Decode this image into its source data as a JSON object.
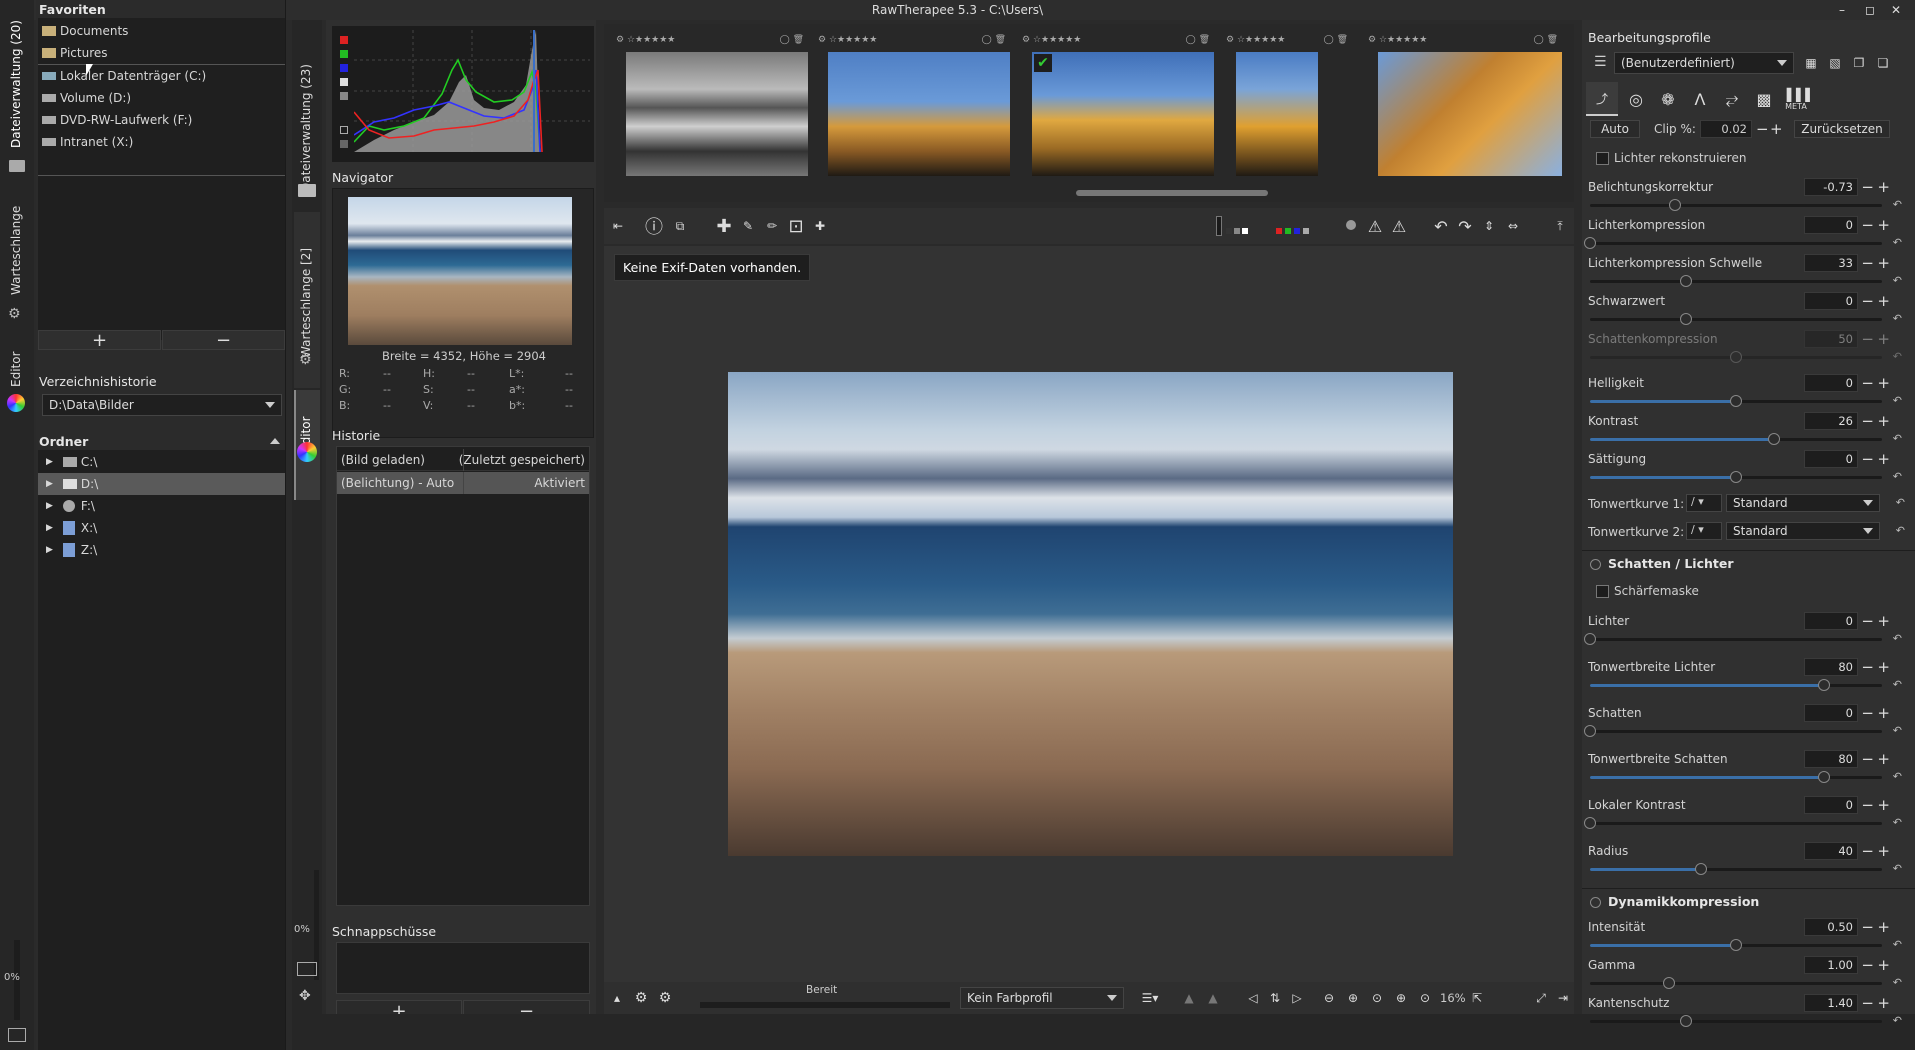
{
  "window": {
    "title": "RawTherapee 5.3 - C:\\Users\\"
  },
  "left_tabs": {
    "file_browser": "Dateiverwaltung (20)",
    "queue": "Warteschlange",
    "editor": "Editor",
    "progress": "0%"
  },
  "inner_tabs": {
    "file_browser": "Dateiverwaltung (23)",
    "queue": "Warteschlange [2]",
    "editor": "Editor",
    "progress": "0%"
  },
  "places": {
    "header": "Favoriten",
    "favorites": [
      "Documents",
      "Pictures"
    ],
    "drives": [
      "Lokaler Datenträger (C:)",
      "Volume (D:)",
      "DVD-RW-Laufwerk (F:)",
      "Intranet (X:)"
    ]
  },
  "dir_history": {
    "label": "Verzeichnishistorie",
    "value": "D:\\Data\\Bilder"
  },
  "folders": {
    "header": "Ordner",
    "items": [
      "C:\\",
      "D:\\",
      "F:\\",
      "X:\\",
      "Z:\\"
    ]
  },
  "navigator": {
    "title": "Navigator",
    "dims": "Breite = 4352, Höhe = 2904",
    "readout": [
      [
        "R:",
        "--",
        "H:",
        "--",
        "L*:",
        "--"
      ],
      [
        "G:",
        "--",
        "S:",
        "--",
        "a*:",
        "--"
      ],
      [
        "B:",
        "--",
        "V:",
        "--",
        "b*:",
        "--"
      ]
    ]
  },
  "history": {
    "title": "Historie",
    "rows": [
      [
        "(Bild geladen)",
        "(Zuletzt gespeichert)"
      ],
      [
        "(Belichtung) - Auto",
        "Aktiviert"
      ]
    ]
  },
  "snapshots": {
    "title": "Schnappschüsse"
  },
  "exif_tooltip": "Keine Exif-Daten vorhanden.",
  "statusbar": {
    "status": "Bereit",
    "color_profile": "Kein Farbprofil",
    "zoom": "16%"
  },
  "right": {
    "profiles_title": "Bearbeitungsprofile",
    "profile_value": "(Benutzerdefiniert)",
    "meta_label": "META",
    "auto": "Auto",
    "clip_label": "Clip %:",
    "clip_value": "0.02",
    "reset": "Zurücksetzen",
    "reconstruct": "Lichter rekonstruieren",
    "sliders1": [
      {
        "label": "Belichtungskorrektur",
        "value": "-0.73",
        "pos": 0.29,
        "disabled": false,
        "fill": false
      },
      {
        "label": "Lichterkompression",
        "value": "0",
        "pos": 0,
        "disabled": false,
        "fill": false
      },
      {
        "label": "Lichterkompression Schwelle",
        "value": "33",
        "pos": 0.33,
        "disabled": false,
        "fill": false
      },
      {
        "label": "Schwarzwert",
        "value": "0",
        "pos": 0.33,
        "disabled": false,
        "fill": false
      },
      {
        "label": "Schattenkompression",
        "value": "50",
        "pos": 0.5,
        "disabled": true,
        "fill": false
      }
    ],
    "sliders2": [
      {
        "label": "Helligkeit",
        "value": "0",
        "pos": 0.5,
        "fill": true
      },
      {
        "label": "Kontrast",
        "value": "26",
        "pos": 0.63,
        "fill": true
      },
      {
        "label": "Sättigung",
        "value": "0",
        "pos": 0.5,
        "fill": true
      }
    ],
    "curve1_label": "Tonwertkurve 1:",
    "curve1_value": "Standard",
    "curve2_label": "Tonwertkurve 2:",
    "curve2_value": "Standard",
    "sh_title": "Schatten / Lichter",
    "sharpmask": "Schärfemaske",
    "sliders3": [
      {
        "label": "Lichter",
        "value": "0",
        "pos": 0,
        "fill": false
      },
      {
        "label": "Tonwertbreite Lichter",
        "value": "80",
        "pos": 0.8,
        "fill": true
      },
      {
        "label": "Schatten",
        "value": "0",
        "pos": 0,
        "fill": false
      },
      {
        "label": "Tonwertbreite Schatten",
        "value": "80",
        "pos": 0.8,
        "fill": true
      },
      {
        "label": "Lokaler Kontrast",
        "value": "0",
        "pos": 0,
        "fill": false
      },
      {
        "label": "Radius",
        "value": "40",
        "pos": 0.38,
        "fill": true
      }
    ],
    "dr_title": "Dynamikkompression",
    "sliders4": [
      {
        "label": "Intensität",
        "value": "0.50",
        "pos": 0.5,
        "fill": true
      },
      {
        "label": "Gamma",
        "value": "1.00",
        "pos": 0.27,
        "fill": false
      },
      {
        "label": "Kantenschutz",
        "value": "1.40",
        "pos": 0.33,
        "fill": false
      }
    ]
  },
  "colors": {
    "accent": "#3a6fa8",
    "bg": "#2a2a2a",
    "panel": "#353535"
  }
}
